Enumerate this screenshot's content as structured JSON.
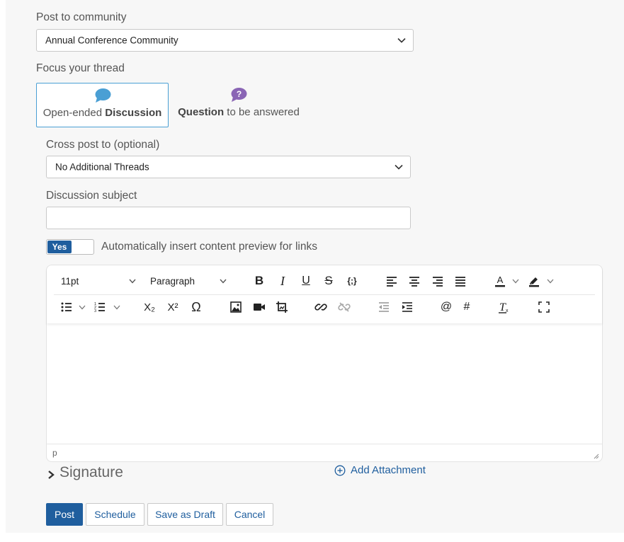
{
  "community": {
    "label": "Post to community",
    "selected": "Annual Conference Community"
  },
  "focus": {
    "label": "Focus your thread",
    "discussion": {
      "prefix": "Open-ended ",
      "bold": "Discussion",
      "icon": "speech-bubble-icon",
      "color": "#4a9fd4"
    },
    "question": {
      "bold": "Question",
      "suffix": " to be answered",
      "icon": "question-bubble-icon",
      "color": "#8a65b5"
    }
  },
  "crosspost": {
    "label": "Cross post to (optional)",
    "selected": "No Additional Threads"
  },
  "subject": {
    "label": "Discussion subject",
    "value": ""
  },
  "preview_toggle": {
    "state_label": "Yes",
    "label": "Automatically insert content preview for links"
  },
  "editor": {
    "font_size": "11pt",
    "block_format": "Paragraph",
    "status_path": "p",
    "row1_icons": [
      "bold-icon",
      "italic-icon",
      "underline-icon",
      "strikethrough-icon",
      "code-icon",
      "align-left-icon",
      "align-center-icon",
      "align-right-icon",
      "align-justify-icon",
      "text-color-icon",
      "highlight-color-icon"
    ],
    "row2_icons": [
      "bullet-list-icon",
      "numbered-list-icon",
      "subscript-icon",
      "superscript-icon",
      "special-char-icon",
      "image-icon",
      "video-icon",
      "media-icon",
      "link-icon",
      "unlink-icon",
      "outdent-icon",
      "indent-icon",
      "mention-icon",
      "hashtag-icon",
      "clear-format-icon",
      "fullscreen-icon"
    ],
    "glyphs": {
      "bold": "B",
      "italic": "I",
      "underline": "U",
      "strike": "S",
      "code": "{;}",
      "omega": "Ω",
      "at": "@",
      "hash": "#",
      "clear": "Tx",
      "sub": "X₂",
      "sup": "X²"
    }
  },
  "signature": {
    "label": "Signature"
  },
  "attachment": {
    "label": "Add Attachment"
  },
  "actions": {
    "post": "Post",
    "schedule": "Schedule",
    "draft": "Save as Draft",
    "cancel": "Cancel"
  },
  "colors": {
    "primary": "#1f5e9e",
    "panel": "#f7f7f7"
  }
}
